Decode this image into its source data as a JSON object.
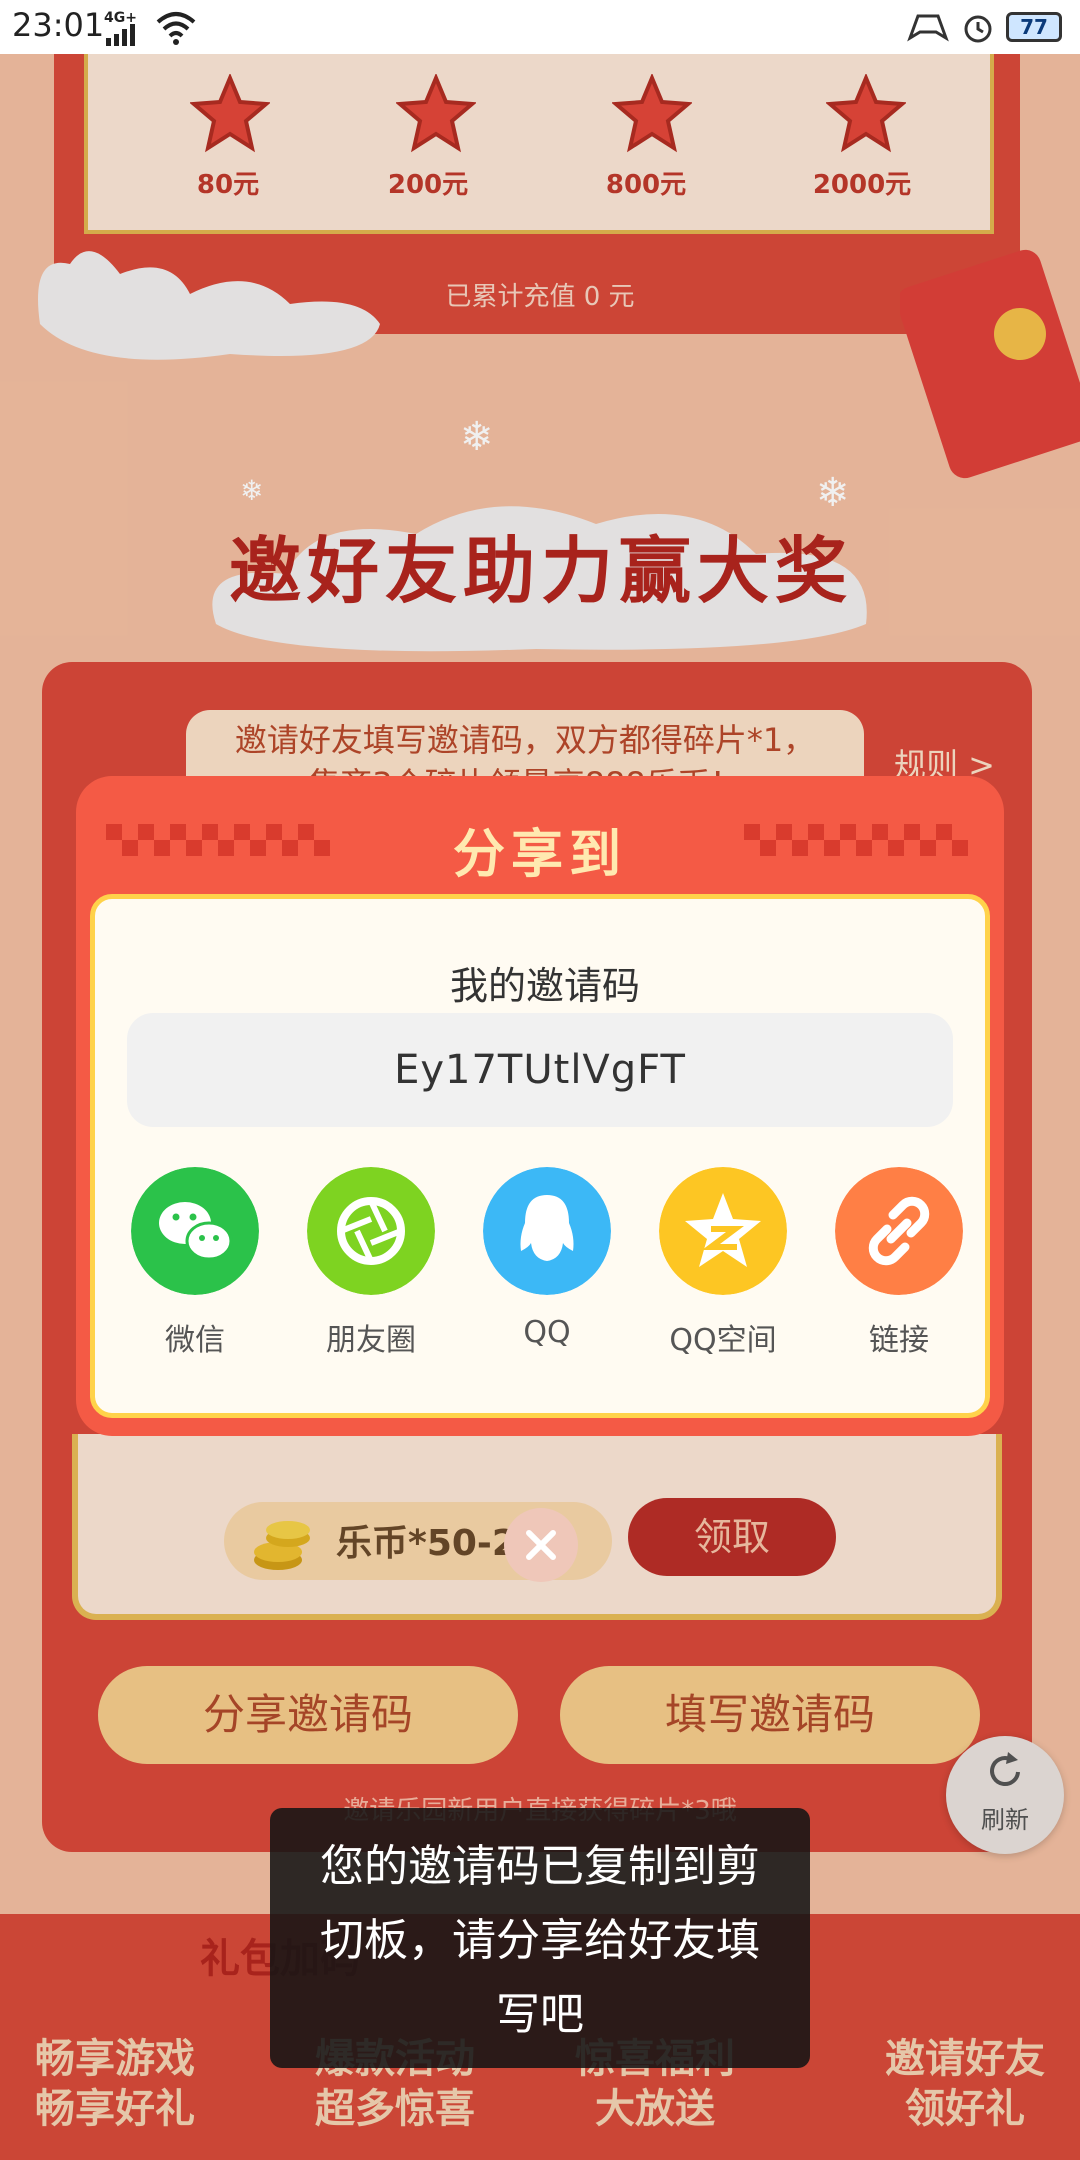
{
  "status_bar": {
    "time": "23:01",
    "network": "4G+",
    "battery": "77"
  },
  "top_rewards": {
    "items": [
      {
        "label": "80元"
      },
      {
        "label": "200元"
      },
      {
        "label": "800元"
      },
      {
        "label": "2000元"
      }
    ],
    "cumulative_text": "已累计充值 0 元"
  },
  "section_title": "邀好友助力赢大奖",
  "banner": {
    "text": "邀请好友填写邀请码，双方都得碎片*1，",
    "text2": "集齐3个碎片领最高888乐币！",
    "rules_link": "规则 >"
  },
  "reward_row": {
    "coin_text": "乐币*50-233",
    "claim_label": "领取"
  },
  "buttons": {
    "share_code": "分享邀请码",
    "fill_code": "填写邀请码"
  },
  "invite_hint": "邀请乐园新用户直接获得碎片*3哦",
  "refresh": {
    "label": "刷新"
  },
  "bottom_nav": {
    "items": [
      {
        "line1": "畅享游戏",
        "line2": "畅享好礼"
      },
      {
        "line1": "爆款活动",
        "line2": "超多惊喜"
      },
      {
        "line1": "惊喜福利",
        "line2": "大放送"
      },
      {
        "line1": "邀请好友",
        "line2": "领好礼"
      }
    ],
    "banner_text": "礼包加码"
  },
  "dialog": {
    "title": "分享到",
    "code_label": "我的邀请码",
    "code_value": "Ey17TUtlVgFT",
    "share_targets": [
      {
        "label": "微信",
        "icon": "wechat-icon",
        "color": "#2bc24a"
      },
      {
        "label": "朋友圈",
        "icon": "moments-icon",
        "color": "#7ed321"
      },
      {
        "label": "QQ",
        "icon": "qq-icon",
        "color": "#3cb8f6"
      },
      {
        "label": "QQ空间",
        "icon": "qzone-icon",
        "color": "#fdc623"
      },
      {
        "label": "链接",
        "icon": "link-icon",
        "color": "#ff7f45"
      }
    ]
  },
  "toast": {
    "line1": "您的邀请码已复制到剪",
    "line2": "切板，请分享给好友填",
    "line3": "写吧"
  }
}
